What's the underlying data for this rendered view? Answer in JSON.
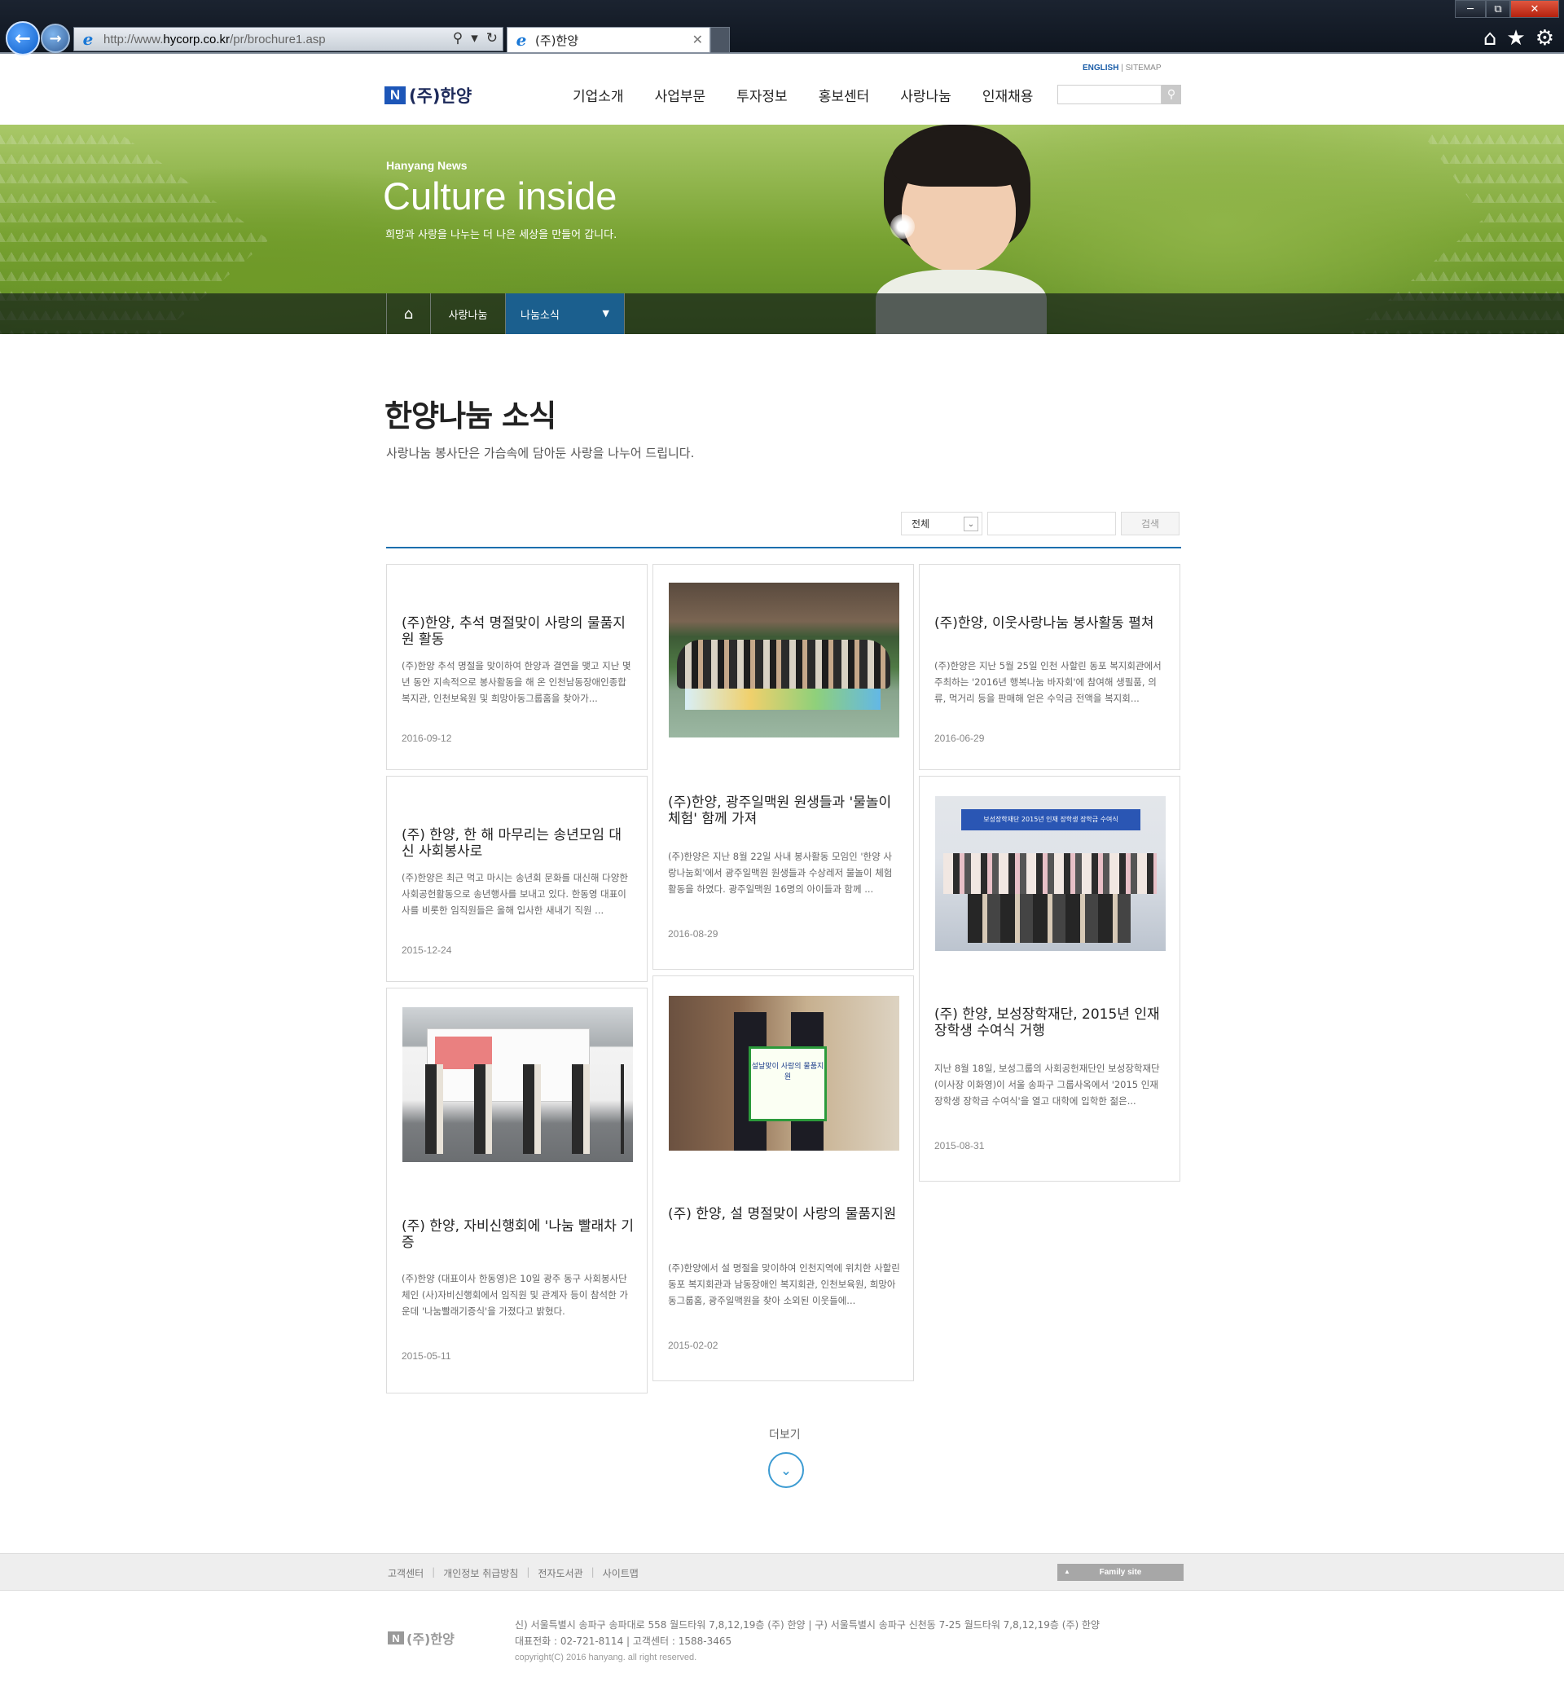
{
  "browser": {
    "url_prefix": "http://www.",
    "url_domain": "hycorp.co.kr",
    "url_path": "/pr/brochure1.asp",
    "tab_title": "(주)한양"
  },
  "header": {
    "util_english": "ENGLISH",
    "util_sep": "|",
    "util_sitemap": "SITEMAP",
    "logo_text": "(주)한양",
    "nav": [
      "기업소개",
      "사업부문",
      "투자정보",
      "홍보센터",
      "사랑나눔",
      "인재채용"
    ]
  },
  "banner": {
    "subtitle": "Hanyang News",
    "title": "Culture inside",
    "desc": "희망과 사랑을 나누는 더 나은 세상을 만들어 갑니다."
  },
  "lnb": {
    "level1": "사랑나눔",
    "level2": "나눔소식"
  },
  "content": {
    "title": "한양나눔 소식",
    "desc": "사랑나눔 봉사단은 가슴속에 담아둔 사랑을 나누어 드립니다.",
    "filter_select": "전체",
    "search_button": "검색"
  },
  "cards": [
    {
      "title": "(주)한양, 추석 명절맞이 사랑의 물품지원 활동",
      "excerpt": "(주)한양 추석 명절을 맞이하여 한양과 결연을 맺고 지난 몇 년 동안 지속적으로 봉사활동을 해 온 인천남동장애인종합복지관, 인천보육원 및 희망아동그룹홈을 찾아가...",
      "date": "2016-09-12"
    },
    {
      "title": "(주)한양, 광주일맥원 원생들과 '물놀이 체험' 함께 가져",
      "excerpt": "(주)한양은 지난 8월 22일 사내 봉사활동 모임인 '한양 사랑나눔회'에서 광주일맥원 원생들과 수상레저 물놀이 체험활동을 하였다. 광주일맥원 16명의 아이들과 함께 ...",
      "date": "2016-08-29"
    },
    {
      "title": "(주)한양, 이웃사랑나눔 봉사활동 펼쳐",
      "excerpt": "(주)한양은 지난 5월 25일 인천 사할린 동포 복지회관에서 주최하는 '2016년 행복나눔 바자회'에 참여해 생필품, 의류, 먹거리 등을 판매해 얻은 수익금 전액을 복지회...",
      "date": "2016-06-29"
    },
    {
      "title": "(주) 한양, 한 해 마무리는 송년모임 대신 사회봉사로",
      "excerpt": "(주)한양은 최근 먹고 마시는 송년회 문화를 대신해 다양한 사회공헌활동으로 송년행사를 보내고 있다. 한동영 대표이사를 비롯한 임직원들은 올해 입사한 새내기 직원 ...",
      "date": "2015-12-24"
    },
    {
      "title": "(주) 한양, 보성장학재단, 2015년 인재 장학생 수여식 거행",
      "excerpt": "지난 8월 18일, 보성그룹의 사회공헌재단인 보성장학재단(이사장 이화영)이 서울 송파구 그룹사옥에서 '2015 인재 장학생 장학금 수여식'을 열고 대학에 입학한 젊은...",
      "date": "2015-08-31",
      "photo_banner": "보성장학재단 2015년 인재 장학생 장학금 수여식"
    },
    {
      "title": "(주) 한양, 자비신행회에 '나눔 빨래차 기증",
      "excerpt": "(주)한양 (대표이사 한동영)은 10일 광주 동구 사회봉사단체인 (사)자비신행회에서 임직원 및 관계자 등이 참석한 가운데 '나눔빨래기증식'을 가졌다고 밝혔다.",
      "date": "2015-05-11",
      "photo_sign": "나눔빨래차"
    },
    {
      "title": "(주) 한양, 설 명절맞이 사랑의 물품지원",
      "excerpt": "(주)한양에서 설 명절을 맞이하여 인천지역에 위치한 사할린동포 복지회관과 남동장애인 복지회관, 인천보육원, 희망아동그룹홈, 광주일맥원을 찾아 소외된 이웃들에...",
      "date": "2015-02-02",
      "photo_sign": "설날맞이 사랑의 물품지원"
    }
  ],
  "more_label": "더보기",
  "footer": {
    "links": [
      "고객센터",
      "개인정보 취급방침",
      "전자도서관",
      "사이트맵"
    ],
    "family_site": "Family site",
    "address": "신) 서울특별시 송파구 송파대로 558 월드타워 7,8,12,19층 (주) 한양  |  구) 서울특별시 송파구 신천동 7-25 월드타워 7,8,12,19층 (주) 한양",
    "phone": "대표전화 : 02-721-8114  |  고객센터 : 1588-3465",
    "copyright": "copyright(C) 2016 hanyang. all right reserved."
  }
}
